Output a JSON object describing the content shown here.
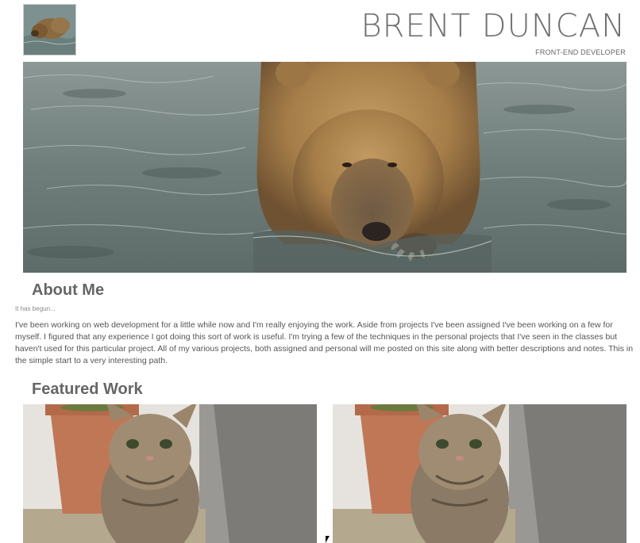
{
  "header": {
    "name": "BRENT DUNCAN",
    "role": "FRONT-END DEVELOPER",
    "logo_icon": "bear-thumbnail"
  },
  "hero": {
    "image": "bear-in-water-photo"
  },
  "about": {
    "title": "About Me",
    "subtitle": "It has begun...",
    "body": "I've been working on web development for a little while now and I'm really enjoying the work. Aside from projects I've been assigned I've been working on a few for myself. I figured that any experience I got doing this sort of work is useful. I'm trying a few of the techniques in the personal projects that I've seen in the classes but haven't used for this particular project. All of my various projects, both assigned and personal will me posted on this site along with better descriptions and notes. This in the simple start to a very interesting path."
  },
  "featured": {
    "title": "Featured Work",
    "items": [
      {
        "image": "kitten-photo"
      },
      {
        "image": "kitten-photo"
      }
    ]
  }
}
